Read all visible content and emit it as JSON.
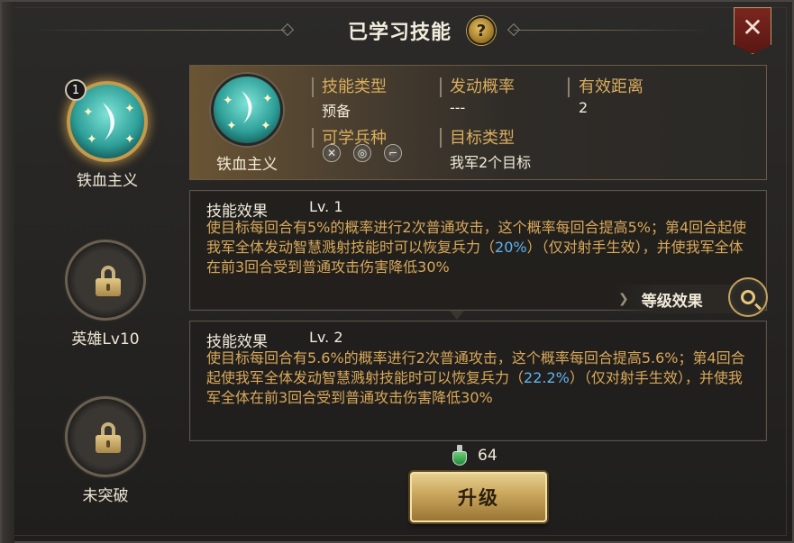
{
  "header": {
    "title": "已学习技能",
    "help_label": "?",
    "close_label": "✕"
  },
  "slots": [
    {
      "number": "1",
      "label": "铁血主义",
      "state": "active",
      "icon": "skill-crescent-icon"
    },
    {
      "label": "英雄Lv10",
      "state": "locked",
      "icon": "lock-icon"
    },
    {
      "label": "未突破",
      "state": "locked",
      "icon": "lock-icon"
    }
  ],
  "skill_info": {
    "name": "铁血主义",
    "type_label": "技能类型",
    "type_value": "预备",
    "chance_label": "发动概率",
    "chance_value": "---",
    "range_label": "有效距离",
    "range_value": "2",
    "troops_label": "可学兵种",
    "troops": [
      "crossed-swords-icon",
      "target-icon",
      "gun-icon"
    ],
    "target_label": "目标类型",
    "target_value": "我军2个目标"
  },
  "effects": [
    {
      "head": "技能效果",
      "level": "Lv. 1",
      "text_a": "使目标每回合有5%的概率进行2次普通攻击，这个概率每回合提高5%；第4回合起使我军全体发动智慧溅射技能时可以恢复兵力（",
      "highlight": "20%",
      "text_b": "）（仅对射手生效），并使我军全体在前3回合受到普通攻击伤害降低30%"
    },
    {
      "head": "技能效果",
      "level": "Lv. 2",
      "text_a": "使目标每回合有5.6%的概率进行2次普通攻击，这个概率每回合提高5.6%；第4回合起使我军全体发动智慧溅射技能时可以恢复兵力（",
      "highlight": "22.2%",
      "text_b": "）（仅对射手生效），并使我军全体在前3回合受到普通攻击伤害降低30%"
    }
  ],
  "level_effect_label": "等级效果",
  "cost": {
    "icon": "potion-icon",
    "amount": "64"
  },
  "upgrade_label": "升级",
  "colors": {
    "accent": "#d9ad5e",
    "highlight": "#5fb4ef",
    "effect_text": "#d8a85a"
  }
}
